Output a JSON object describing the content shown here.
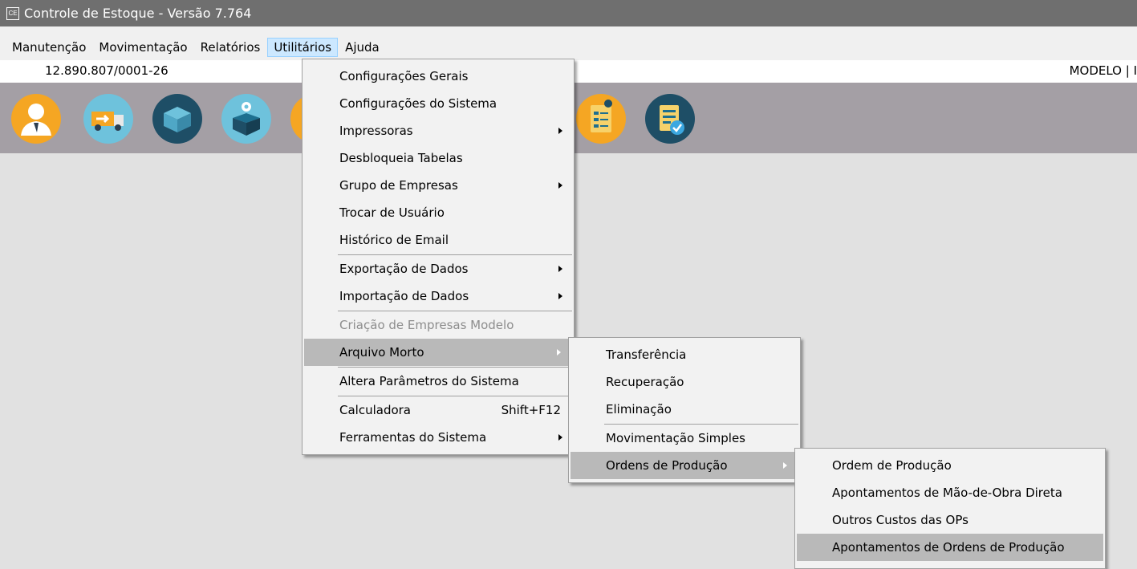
{
  "window": {
    "icon_text": "CE",
    "title": "Controle de Estoque - Versão 7.764"
  },
  "menubar": [
    "Manutenção",
    "Movimentação",
    "Relatórios",
    "Utilitários",
    "Ajuda"
  ],
  "infobar": {
    "cnpj": "12.890.807/0001-26",
    "right_text": "MODELO | I"
  },
  "toolbar": {
    "icons": [
      "user-icon",
      "truck-icon",
      "box-icon",
      "box-settings-icon",
      "box-partial-icon",
      "checklist-pin-icon",
      "clipboard-check-icon"
    ]
  },
  "utilitarios_menu": {
    "items": [
      {
        "label": "Configurações Gerais"
      },
      {
        "label": "Configurações do Sistema"
      },
      {
        "label": "Impressoras",
        "submenu": true
      },
      {
        "label": "Desbloqueia Tabelas"
      },
      {
        "label": "Grupo de Empresas",
        "submenu": true
      },
      {
        "label": "Trocar de Usuário"
      },
      {
        "label": "Histórico de Email"
      },
      {
        "label": "Exportação de Dados",
        "submenu": true
      },
      {
        "label": "Importação de Dados",
        "submenu": true
      },
      {
        "label": "Criação de Empresas Modelo",
        "disabled": true
      },
      {
        "label": "Arquivo Morto",
        "submenu": true,
        "highlighted": true
      },
      {
        "label": "Altera Parâmetros do Sistema"
      },
      {
        "label": "Calculadora",
        "shortcut": "Shift+F12"
      },
      {
        "label": "Ferramentas do Sistema",
        "submenu": true
      }
    ]
  },
  "arquivo_morto_menu": {
    "items": [
      {
        "label": "Transferência"
      },
      {
        "label": "Recuperação"
      },
      {
        "label": "Eliminação"
      },
      {
        "label": "Movimentação Simples"
      },
      {
        "label": "Ordens de Produção",
        "submenu": true,
        "highlighted": true
      }
    ]
  },
  "ordens_menu": {
    "items": [
      {
        "label": "Ordem de Produção"
      },
      {
        "label": "Apontamentos de Mão-de-Obra Direta"
      },
      {
        "label": "Outros Custos das OPs"
      },
      {
        "label": "Apontamentos de Ordens de Produção",
        "highlighted": true
      }
    ]
  }
}
